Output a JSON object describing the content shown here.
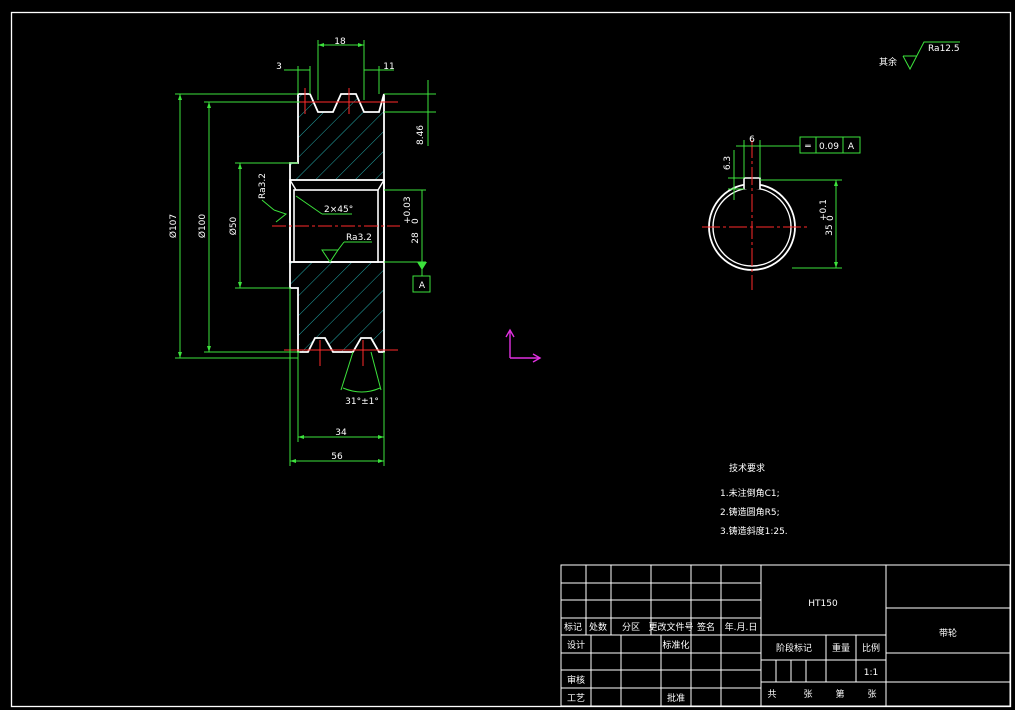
{
  "dimensions": {
    "top_width": "18",
    "left_offset": "3",
    "right_offset": "11",
    "groove_depth": "8.46",
    "dia_outer": "Ø107",
    "dia_pitch": "Ø100",
    "dia_hub": "Ø50",
    "bore_dia": "28",
    "bore_tol_upper": "+0.03",
    "bore_tol_lower": "0",
    "chamfer": "2×45°",
    "groove_angle": "31°±1°",
    "rim_width": "34",
    "total_width": "56",
    "keyway_width": "6",
    "keyway_depth": "6.3",
    "key_dim": "35",
    "key_dim_tol_upper": "+0.1",
    "key_dim_tol_lower": "0",
    "datum": "A"
  },
  "roughness": {
    "rest_label": "其余",
    "rest_value": "Ra12.5",
    "bore_left": "Ra3.2",
    "bore_value": "Ra3.2"
  },
  "tolerance_frame": {
    "symbol": "═",
    "value": "0.09",
    "datum": "A"
  },
  "tech_requirements": {
    "title": "技术要求",
    "items": [
      "1.未注倒角C1;",
      "2.铸造圆角R5;",
      "3.铸造斜度1:25."
    ]
  },
  "title_block": {
    "material": "HT150",
    "part_name": "带轮",
    "header_labels": [
      "标记",
      "处数",
      "分区",
      "更改文件号",
      "签名",
      "年.月.日"
    ],
    "left_rows": [
      "设计",
      "审核",
      "工艺"
    ],
    "standardization": "标准化",
    "approval": "批准",
    "stage_mark": "阶段标记",
    "weight": "重量",
    "scale_label": "比例",
    "scale_value": "1:1",
    "sheet_row": [
      "共",
      "张",
      "第",
      "张"
    ]
  }
}
